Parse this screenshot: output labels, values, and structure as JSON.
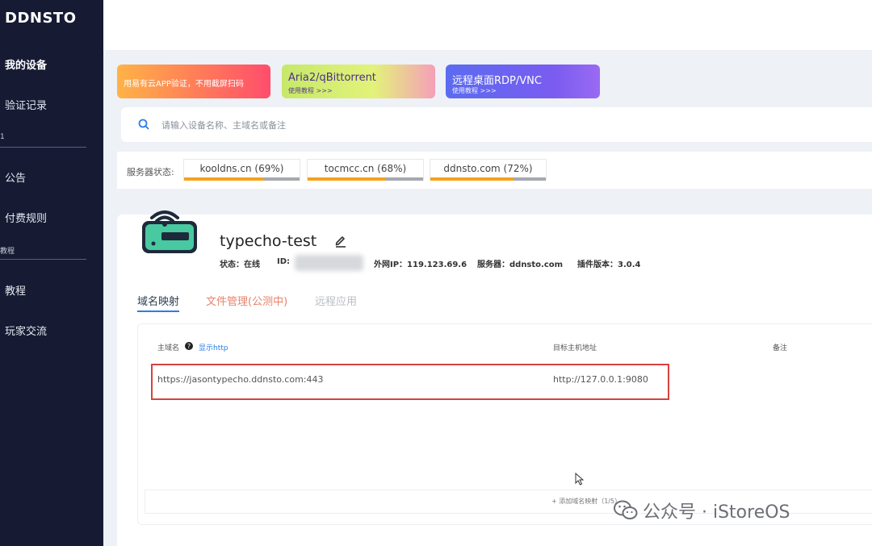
{
  "sidebar": {
    "brand": "DDNSTO",
    "items": [
      {
        "label": "我的设备"
      },
      {
        "label": "验证记录"
      },
      {
        "label": "公告"
      },
      {
        "label": "付费规则"
      },
      {
        "label": "教程"
      },
      {
        "label": "玩家交流"
      }
    ],
    "groups": [
      "1",
      "教程"
    ]
  },
  "banners": [
    {
      "title": "用易有云APP验证，不用截屏扫码",
      "subtitle": ""
    },
    {
      "title": "Aria2/qBittorrent",
      "subtitle": "使用教程 >>>"
    },
    {
      "title": "远程桌面RDP/VNC",
      "subtitle": "使用教程 >>>"
    }
  ],
  "search": {
    "placeholder": "请输入设备名称、主域名或备注",
    "value": ""
  },
  "servers": {
    "label": "服务器状态:",
    "items": [
      {
        "text": "kooldns.cn (69%)",
        "load": 0.69
      },
      {
        "text": "tocmcc.cn (68%)",
        "load": 0.68
      },
      {
        "text": "ddnsto.com (72%)",
        "load": 0.72
      }
    ]
  },
  "device": {
    "name": "typecho-test",
    "status": "状态：在线",
    "id_label": "ID:",
    "ip": "外网IP：119.123.69.6",
    "server": "服务器：ddnsto.com",
    "plugin": "插件版本：3.0.4"
  },
  "tabs": [
    {
      "label": "域名映射"
    },
    {
      "label": "文件管理(公测中)"
    },
    {
      "label": "远程应用"
    }
  ],
  "table": {
    "headers": {
      "domain": "主域名",
      "show_http": "显示http",
      "target": "目标主机地址",
      "note": "备注"
    },
    "rows": [
      {
        "domain": "https://jasontypecho.ddnsto.com:443",
        "target": "http://127.0.0.1:9080",
        "note": ""
      }
    ],
    "add_label": "+   添加域名映射（1/5）"
  },
  "watermark": {
    "text": "公众号 · iStoreOS"
  },
  "colors": {
    "sidebar": "#161a33",
    "accent": "#2b7de9",
    "highlight": "#d7423f",
    "load": "#f4a21d"
  }
}
